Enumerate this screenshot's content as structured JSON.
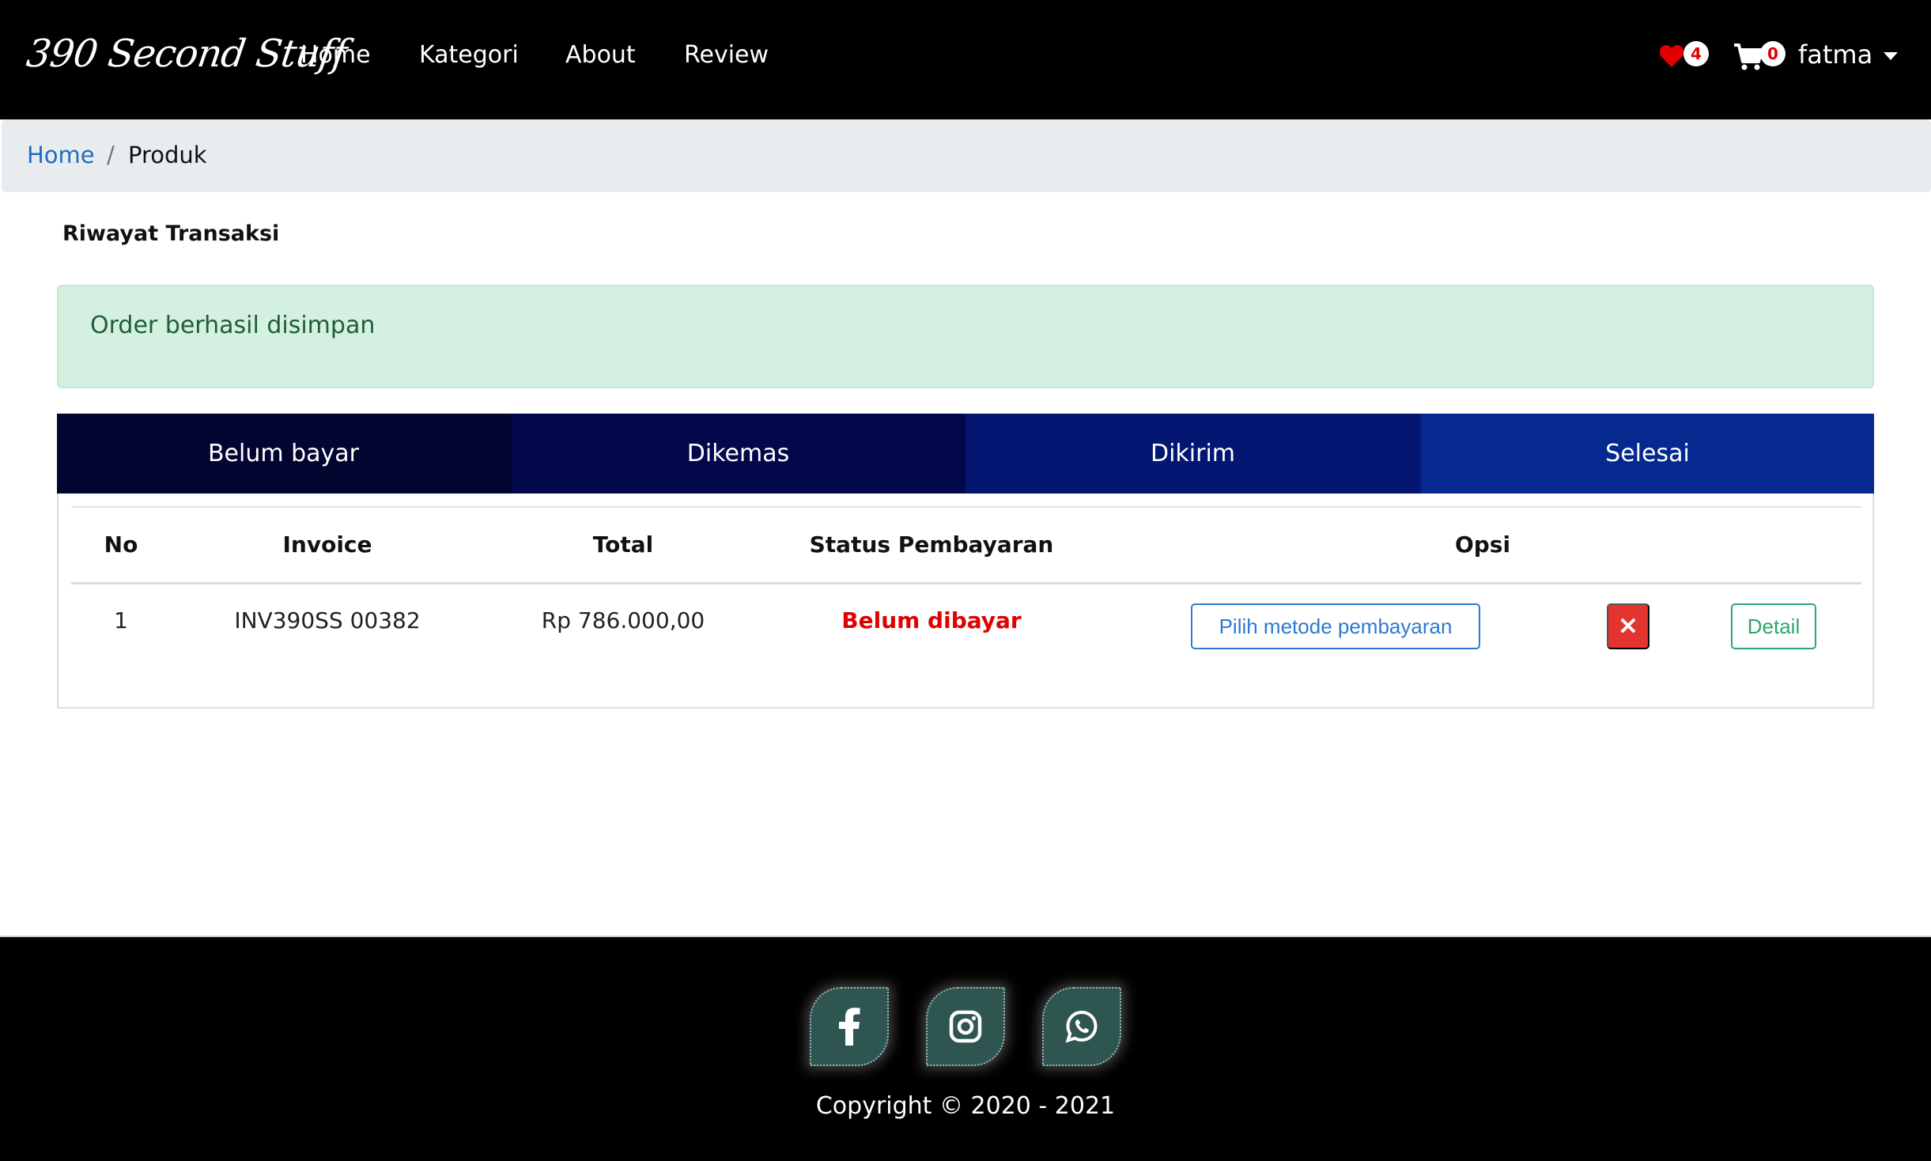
{
  "navbar": {
    "brand": "390 Second Stuff",
    "links": [
      "Home",
      "Kategori",
      "About",
      "Review"
    ],
    "wishlist_count": "4",
    "cart_count": "0",
    "user_name": "fatma"
  },
  "breadcrumb": {
    "home": "Home",
    "separator": "/",
    "current": "Produk"
  },
  "main": {
    "heading": "Riwayat Transaksi",
    "alert": "Order berhasil disimpan",
    "tabs": [
      "Belum bayar",
      "Dikemas",
      "Dikirim",
      "Selesai"
    ],
    "table": {
      "headers": [
        "No",
        "Invoice",
        "Total",
        "Status Pembayaran",
        "Opsi"
      ],
      "rows": [
        {
          "no": "1",
          "invoice": "INV390SS 00382",
          "total": "Rp 786.000,00",
          "status": "Belum dibayar",
          "pay_button": "Pilih metode pembayaran",
          "delete_button": "✕",
          "detail_button": "Detail"
        }
      ]
    }
  },
  "footer": {
    "social_icons": [
      "facebook-icon",
      "instagram-icon",
      "whatsapp-icon"
    ],
    "copyright": "Copyright © 2020 - 2021"
  },
  "colors": {
    "navbar_bg": "#000000",
    "tab_1": "#02052f",
    "tab_2": "#02084b",
    "tab_3": "#031672",
    "tab_4": "#06298f",
    "status_unpaid": "#e00000",
    "alert_bg": "#d4f0e0",
    "pay_button": "#2b7ad1",
    "delete_button": "#e3342f",
    "detail_button": "#2ea66c",
    "social_bg": "#2f5551"
  }
}
